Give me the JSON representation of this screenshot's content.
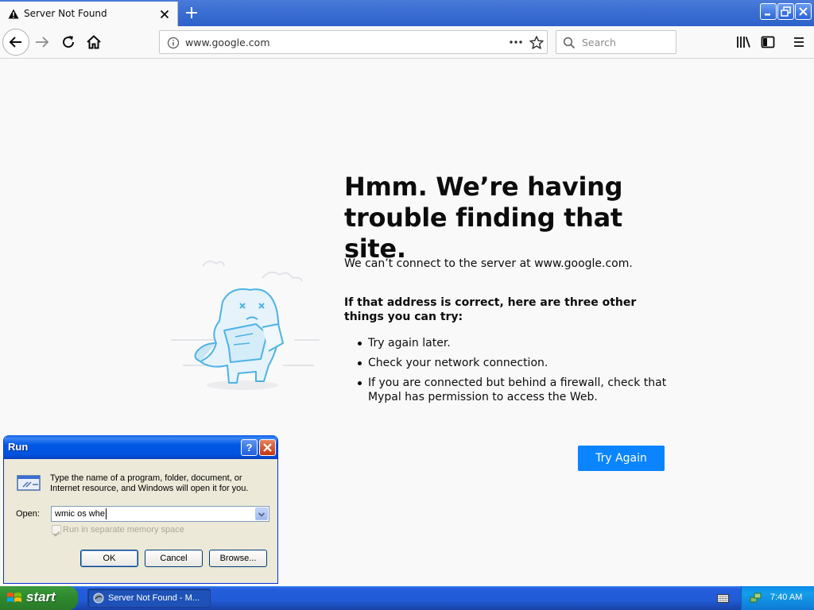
{
  "browser": {
    "tab_title": "Server Not Found",
    "url": "www.google.com",
    "search_placeholder": "Search"
  },
  "error_page": {
    "title": "Hmm. We’re having trouble finding that site.",
    "description": "We can’t connect to the server at www.google.com.",
    "subtitle": "If that address is correct, here are three other things you can try:",
    "suggestions": [
      "Try again later.",
      "Check your network connection.",
      "If you are connected but behind a firewall, check that Mypal has permission to access the Web."
    ],
    "try_again_label": "Try Again",
    "accent_color": "#0a84ff"
  },
  "run_dialog": {
    "title": "Run",
    "help_label": "?",
    "description": "Type the name of a program, folder, document, or Internet resource, and Windows will open it for you.",
    "open_label": "Open:",
    "open_value": "wmic os whe",
    "memory_checkbox_label": "Run in separate memory space",
    "memory_checked": true,
    "ok_label": "OK",
    "cancel_label": "Cancel",
    "browse_label": "Browse..."
  },
  "taskbar": {
    "start_label": "start",
    "task_label": "Server Not Found - M...",
    "clock": "7:40 AM"
  },
  "icons": {
    "tab": "warning-icon",
    "nav": [
      "back-arrow-icon",
      "forward-arrow-icon",
      "reload-icon",
      "home-icon"
    ],
    "url": [
      "info-icon",
      "page-actions-icon",
      "star-icon"
    ],
    "toolbar": [
      "library-icon",
      "sidebar-icon",
      "hamburger-menu-icon"
    ]
  }
}
